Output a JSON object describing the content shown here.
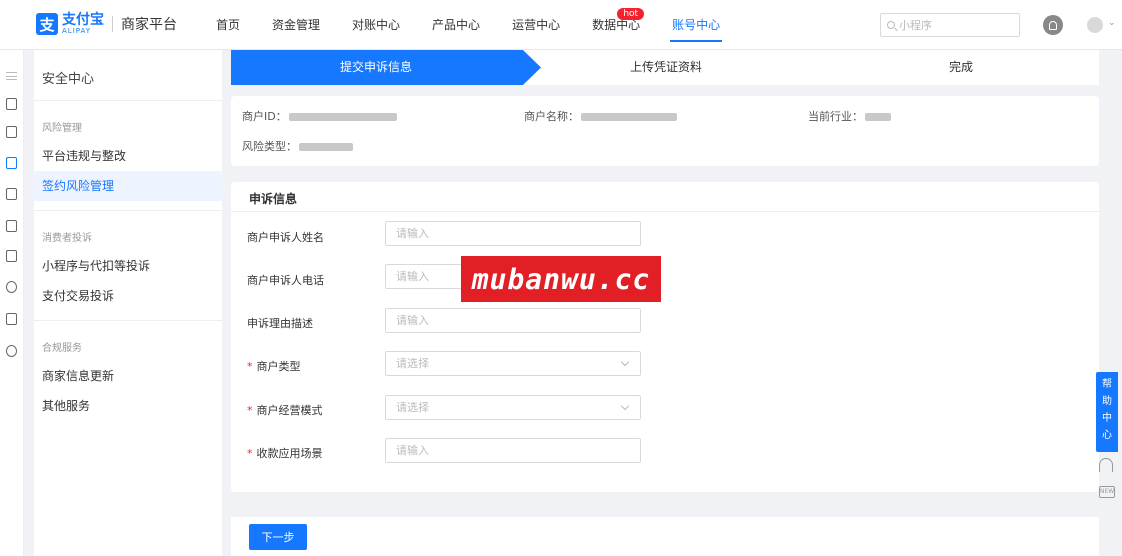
{
  "header": {
    "logo_cn": "支付宝",
    "logo_en": "ALIPAY",
    "platform": "商家平台",
    "nav": [
      {
        "label": "首页"
      },
      {
        "label": "资金管理"
      },
      {
        "label": "对账中心"
      },
      {
        "label": "产品中心"
      },
      {
        "label": "运营中心"
      },
      {
        "label": "数据中心",
        "badge": "hot"
      },
      {
        "label": "账号中心",
        "active": true
      }
    ],
    "search_placeholder": "小程序"
  },
  "sidebar": {
    "title": "安全中心",
    "groups": [
      {
        "label": "风险管理",
        "items": [
          "平台违规与整改",
          "签约风险管理"
        ]
      },
      {
        "label": "消费者投诉",
        "items": [
          "小程序与代扣等投诉",
          "支付交易投诉"
        ]
      },
      {
        "label": "合规服务",
        "items": [
          "商家信息更新",
          "其他服务"
        ]
      }
    ],
    "active_item": "签约风险管理"
  },
  "steps": [
    "提交申诉信息",
    "上传凭证资料",
    "完成"
  ],
  "info": {
    "merchant_id_label": "商户ID：",
    "merchant_name_label": "商户名称：",
    "industry_label": "当前行业：",
    "risk_type_label": "风险类型："
  },
  "form": {
    "title": "申诉信息",
    "fields": [
      {
        "label": "商户申诉人姓名",
        "placeholder": "请输入"
      },
      {
        "label": "商户申诉人电话",
        "placeholder": "请输入"
      },
      {
        "label": "申诉理由描述",
        "placeholder": "请输入"
      },
      {
        "label": "商户类型",
        "placeholder": "请选择",
        "required_mark": "*"
      },
      {
        "label": "商户经营模式",
        "placeholder": "请选择",
        "required_mark": "*"
      },
      {
        "label": "收款应用场景",
        "placeholder": "请输入",
        "required_mark": "*"
      }
    ],
    "next_label": "下一步"
  },
  "watermark": "mubanwu.cc",
  "help": {
    "chars": [
      "帮",
      "助",
      "中",
      "心"
    ],
    "new_label": "NEW"
  },
  "colors": {
    "primary": "#1677ff",
    "danger": "#f5222d",
    "watermark": "#e31f26"
  }
}
